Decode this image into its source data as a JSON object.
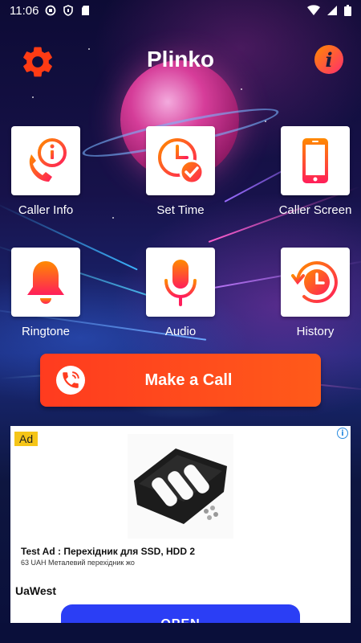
{
  "status_bar": {
    "time": "11:06",
    "left_icons": [
      "notification-icon",
      "shield-icon",
      "sd-card-icon"
    ],
    "right_icons": [
      "wifi-icon",
      "signal-icon",
      "battery-icon"
    ]
  },
  "header": {
    "title": "Plinko",
    "settings_icon": "gear-icon",
    "info_icon": "info-icon",
    "info_glyph": "i"
  },
  "tiles": [
    {
      "label": "Caller Info",
      "icon": "caller-info-icon"
    },
    {
      "label": "Set Time",
      "icon": "clock-check-icon"
    },
    {
      "label": "Caller Screen",
      "icon": "phone-screen-icon"
    },
    {
      "label": "Ringtone",
      "icon": "bell-icon"
    },
    {
      "label": "Audio",
      "icon": "microphone-icon"
    },
    {
      "label": "History",
      "icon": "history-icon"
    }
  ],
  "call_button": {
    "label": "Make a Call",
    "icon": "phone-call-icon"
  },
  "ad": {
    "badge": "Ad",
    "choice_glyph": "i",
    "title": "Test Ad : Перехідник для SSD, HDD 2",
    "description": "63 UAH Металевий перехідник жо",
    "advertiser": "UaWest",
    "cta": "OPEN"
  },
  "colors": {
    "accent_orange": "#ff4a1c",
    "accent_pink": "#ff2d6f",
    "ad_cta_blue": "#2b3ef5",
    "ad_badge_yellow": "#f5c518"
  }
}
